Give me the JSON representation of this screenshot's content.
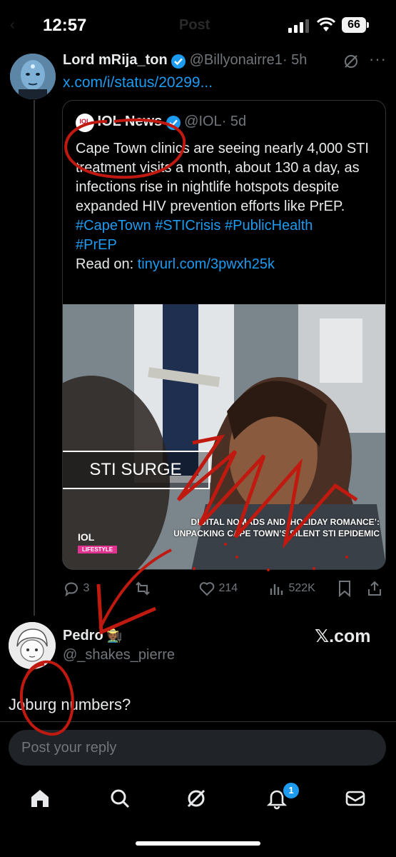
{
  "status_bar": {
    "time": "12:57",
    "battery": "66",
    "faded_title": "Post"
  },
  "main_post": {
    "name": "Lord mRija_ton",
    "handle": "@Billyonairre1",
    "time": "· 5h",
    "link": "x.com/i/status/20299..."
  },
  "quoted_post": {
    "name": "IOL News",
    "handle": "@IOL",
    "time": "· 5d",
    "logo_text": "IOL",
    "body": "Cape Town clinics are seeing nearly 4,000 STI treatment visits a month, about 130 a day, as infections rise in nightlife hotspots despite expanded HIV prevention efforts like PrEP.",
    "hashtags": [
      "#CapeTown",
      "#STICrisis",
      "#PublicHealth",
      "#PrEP"
    ],
    "read_on_label": "Read on:",
    "read_on_link": "tinyurl.com/3pwxh25k",
    "image": {
      "box_label": "STI SURGE",
      "headline_line1": "DIGITAL NOMADS AND ‘HOLIDAY ROMANCE’:",
      "headline_line2": "UNPACKING CAPE TOWN’S SILENT STI EPIDEMIC",
      "logo": "IOL",
      "section": "LIFESTYLE"
    }
  },
  "actions": {
    "replies": "3",
    "likes": "214",
    "views": "522K"
  },
  "reply_post": {
    "name": "Pedro",
    "emoji": "🧑🏾‍🌾",
    "handle": "@_shakes_pierre",
    "watermark": "𝕏.com",
    "text": "Joburg numbers?"
  },
  "reply_box": {
    "placeholder": "Post your reply"
  },
  "tabbar": {
    "notification_count": "1"
  },
  "colors": {
    "accent": "#1d9bf0",
    "background": "#000000",
    "annotation": "#c0190f"
  }
}
